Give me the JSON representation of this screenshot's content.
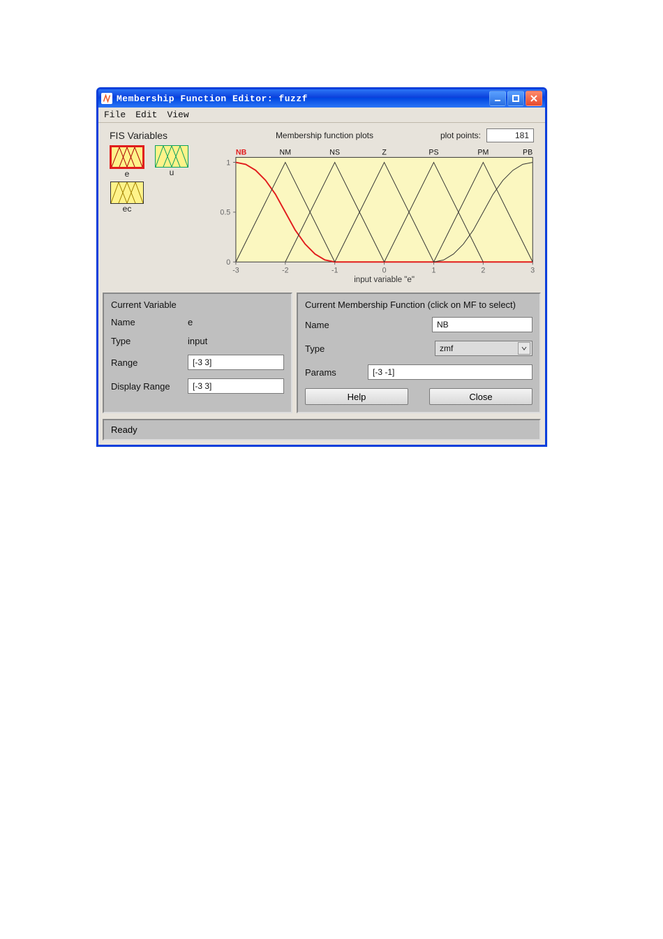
{
  "window": {
    "title": "Membership Function Editor: fuzzf"
  },
  "menu": {
    "file": "File",
    "edit": "Edit",
    "view": "View"
  },
  "vars": {
    "title": "FIS Variables",
    "e": "e",
    "u": "u",
    "ec": "ec"
  },
  "plot_header": {
    "mfplots": "Membership function plots",
    "pp_label": "plot points:",
    "pp_value": "181"
  },
  "chart_data": {
    "type": "line",
    "title": "",
    "xlabel": "input variable \"e\"",
    "ylabel": "",
    "xlim": [
      -3,
      3
    ],
    "ylim": [
      0,
      1.05
    ],
    "xticks": [
      -3,
      -2,
      -1,
      0,
      1,
      2,
      3
    ],
    "yticks": [
      0,
      0.5,
      1
    ],
    "series": [
      {
        "name": "NB",
        "selected": true,
        "type": "zmf",
        "params": [
          -3,
          -1
        ],
        "x": [
          -3.0,
          -2.8,
          -2.6,
          -2.4,
          -2.2,
          -2.0,
          -1.8,
          -1.6,
          -1.4,
          -1.2,
          -1.0,
          -0.8,
          -0.6,
          -0.4,
          -0.2,
          0.0,
          1.0,
          2.0,
          3.0
        ],
        "y": [
          1.0,
          0.98,
          0.92,
          0.82,
          0.68,
          0.5,
          0.32,
          0.18,
          0.08,
          0.02,
          0.0,
          0.0,
          0.0,
          0.0,
          0.0,
          0.0,
          0.0,
          0.0,
          0.0
        ]
      },
      {
        "name": "NM",
        "type": "trimf",
        "params": [
          -3,
          -2,
          -1
        ],
        "x": [
          -3,
          -2,
          -1
        ],
        "y": [
          0,
          1,
          0
        ]
      },
      {
        "name": "NS",
        "type": "trimf",
        "params": [
          -2,
          -1,
          0
        ],
        "x": [
          -2,
          -1,
          0
        ],
        "y": [
          0,
          1,
          0
        ]
      },
      {
        "name": "Z",
        "type": "trimf",
        "params": [
          -1,
          0,
          1
        ],
        "x": [
          -1,
          0,
          1
        ],
        "y": [
          0,
          1,
          0
        ]
      },
      {
        "name": "PS",
        "type": "trimf",
        "params": [
          0,
          1,
          2
        ],
        "x": [
          0,
          1,
          2
        ],
        "y": [
          0,
          1,
          0
        ]
      },
      {
        "name": "PM",
        "type": "trimf",
        "params": [
          1,
          2,
          3
        ],
        "x": [
          1,
          2,
          3
        ],
        "y": [
          0,
          1,
          0
        ]
      },
      {
        "name": "PB",
        "type": "smf",
        "params": [
          1,
          3
        ],
        "x": [
          1.0,
          1.2,
          1.4,
          1.6,
          1.8,
          2.0,
          2.2,
          2.4,
          2.6,
          2.8,
          3.0
        ],
        "y": [
          0.0,
          0.02,
          0.08,
          0.18,
          0.32,
          0.5,
          0.68,
          0.82,
          0.92,
          0.98,
          1.0
        ]
      }
    ],
    "mf_labels": [
      "NB",
      "NM",
      "NS",
      "Z",
      "PS",
      "PM",
      "PB"
    ]
  },
  "current_var": {
    "panel_title": "Current Variable",
    "name_label": "Name",
    "name_value": "e",
    "type_label": "Type",
    "type_value": "input",
    "range_label": "Range",
    "range_value": "[-3 3]",
    "drange_label": "Display Range",
    "drange_value": "[-3 3]"
  },
  "current_mf": {
    "panel_title": "Current Membership Function (click on MF to select)",
    "name_label": "Name",
    "name_value": "NB",
    "type_label": "Type",
    "type_value": "zmf",
    "params_label": "Params",
    "params_value": "[-3 -1]",
    "help_label": "Help",
    "close_label": "Close"
  },
  "status": "Ready"
}
